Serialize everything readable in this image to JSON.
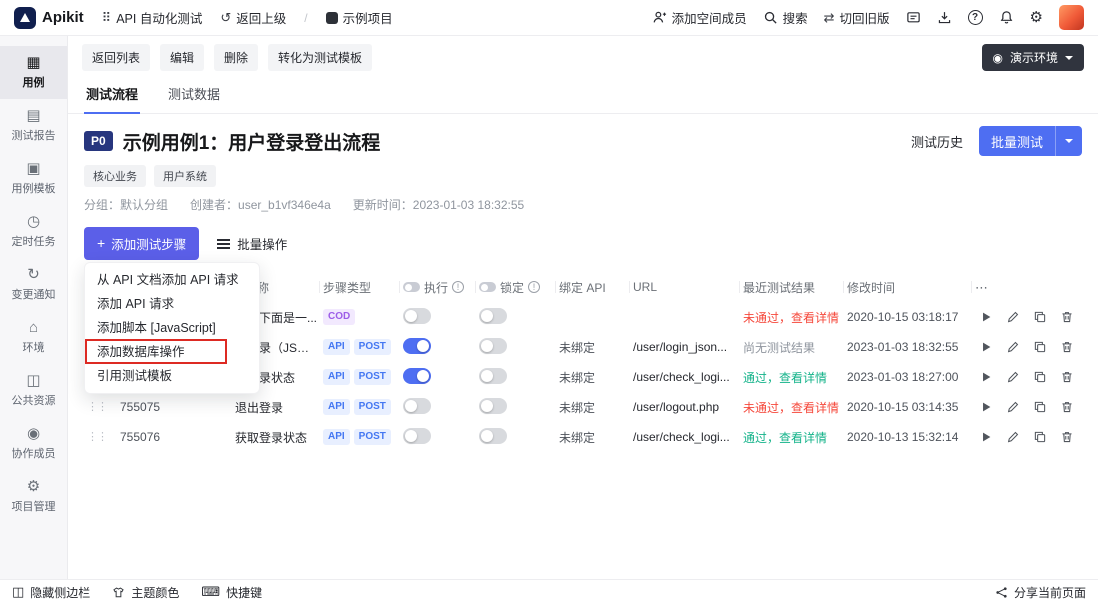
{
  "topbar": {
    "logo_text": "Apikit",
    "module": "API 自动化测试",
    "back_parent": "返回上级",
    "separator": "/",
    "project": "示例项目",
    "add_member": "添加空间成员",
    "search": "搜索",
    "switch_old": "切回旧版"
  },
  "sidebar": {
    "items": [
      {
        "label": "用例",
        "icon": "usecase-grid-icon",
        "active": true
      },
      {
        "label": "测试报告",
        "icon": "report-icon",
        "active": false
      },
      {
        "label": "用例模板",
        "icon": "template-icon",
        "active": false
      },
      {
        "label": "定时任务",
        "icon": "timer-icon",
        "active": false
      },
      {
        "label": "变更通知",
        "icon": "change-notify-icon",
        "active": false
      },
      {
        "label": "环境",
        "icon": "environment-icon",
        "active": false
      },
      {
        "label": "公共资源",
        "icon": "public-resource-icon",
        "active": false
      },
      {
        "label": "协作成员",
        "icon": "members-icon",
        "active": false
      },
      {
        "label": "项目管理",
        "icon": "project-manage-icon",
        "active": false
      }
    ]
  },
  "toolbar": {
    "back_list": "返回列表",
    "edit": "编辑",
    "delete": "删除",
    "to_template": "转化为测试模板",
    "env": "演示环境"
  },
  "tabs": {
    "flow": "测试流程",
    "data": "测试数据"
  },
  "case": {
    "priority": "P0",
    "title": "示例用例1：用户登录登出流程",
    "history": "测试历史",
    "batch_test": "批量测试",
    "tags": [
      "核心业务",
      "用户系统"
    ],
    "group": "分组：默认分组",
    "creator": "创建者：user_b1vf346e4a",
    "updated": "更新时间：2023-01-03 18:32:55"
  },
  "steps": {
    "add_step": "添加测试步骤",
    "batch_ops": "批量操作"
  },
  "menu": {
    "items": [
      "从 API 文档添加 API 请求",
      "添加 API 请求",
      "添加脚本 [JavaScript]",
      "添加数据库操作",
      "引用测试模板"
    ]
  },
  "table": {
    "headers": {
      "name": "名称",
      "type": "步骤类型",
      "exec": "执行",
      "lock": "锁定",
      "bind": "绑定 API",
      "url": "URL",
      "result": "最近测试结果",
      "time": "修改时间"
    },
    "rows": [
      {
        "id": "",
        "name": "下面是一...",
        "badges": [
          {
            "label": "COD",
            "kind": "cod"
          }
        ],
        "exec": false,
        "lock": false,
        "bind": "",
        "url": "",
        "result": "未通过，查看详情",
        "status": "fail",
        "time": "2020-10-15 03:18:17"
      },
      {
        "id": "",
        "name": "录（JSON...",
        "badges": [
          {
            "label": "API",
            "kind": "api"
          },
          {
            "label": "POST",
            "kind": "post"
          }
        ],
        "exec": true,
        "lock": false,
        "bind": "未绑定",
        "url": "/user/login_json...",
        "result": "尚无测试结果",
        "status": "none",
        "time": "2023-01-03 18:32:55"
      },
      {
        "id": "",
        "name": "录状态",
        "badges": [
          {
            "label": "API",
            "kind": "api"
          },
          {
            "label": "POST",
            "kind": "post"
          }
        ],
        "exec": true,
        "lock": false,
        "bind": "未绑定",
        "url": "/user/check_logi...",
        "result": "通过，查看详情",
        "status": "pass",
        "time": "2023-01-03 18:27:00"
      },
      {
        "id": "755075",
        "name": "退出登录",
        "badges": [
          {
            "label": "API",
            "kind": "api"
          },
          {
            "label": "POST",
            "kind": "post"
          }
        ],
        "exec": false,
        "lock": false,
        "bind": "未绑定",
        "url": "/user/logout.php",
        "result": "未通过，查看详情",
        "status": "fail",
        "time": "2020-10-15 03:14:35"
      },
      {
        "id": "755076",
        "name": "获取登录状态",
        "badges": [
          {
            "label": "API",
            "kind": "api"
          },
          {
            "label": "POST",
            "kind": "post"
          }
        ],
        "exec": false,
        "lock": false,
        "bind": "未绑定",
        "url": "/user/check_logi...",
        "result": "通过，查看详情",
        "status": "pass",
        "time": "2020-10-13 15:32:14"
      }
    ]
  },
  "footer": {
    "hide_sidebar": "隐藏侧边栏",
    "theme": "主题颜色",
    "shortcuts": "快捷键",
    "share": "分享当前页面"
  },
  "colors": {
    "accent_blue": "#4e6ef2",
    "primary_purple": "#5b5fe8",
    "fail_red": "#f5483b",
    "pass_teal": "#14b38a",
    "muted_gray": "#8f959e"
  }
}
